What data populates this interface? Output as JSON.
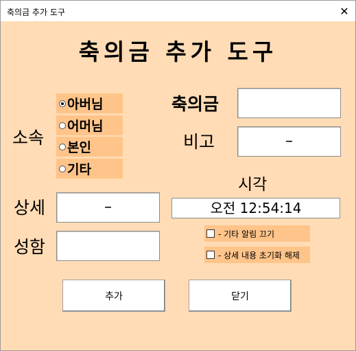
{
  "window": {
    "title": "축의금 추가 도구",
    "close_glyph": "✕"
  },
  "heading": "축의금 추가 도구",
  "labels": {
    "relation": "소속",
    "amount": "축의금",
    "note": "비고",
    "detail": "상세",
    "name": "성함",
    "time": "시각"
  },
  "relation_options": [
    {
      "label": "아버님",
      "selected": true
    },
    {
      "label": "어머님",
      "selected": false
    },
    {
      "label": "본인",
      "selected": false
    },
    {
      "label": "기타",
      "selected": false
    }
  ],
  "fields": {
    "amount_value": "",
    "note_value": "–",
    "detail_value": "–",
    "name_value": ""
  },
  "clock": "오전 12:54:14",
  "options": [
    {
      "label": "- 기타 알림 끄기",
      "checked": false
    },
    {
      "label": "- 상세 내용 초기화 해제",
      "checked": false
    }
  ],
  "buttons": {
    "add": "추가",
    "close": "닫기"
  },
  "colors": {
    "background": "#ffdcb5",
    "accent": "#ffc48a"
  }
}
